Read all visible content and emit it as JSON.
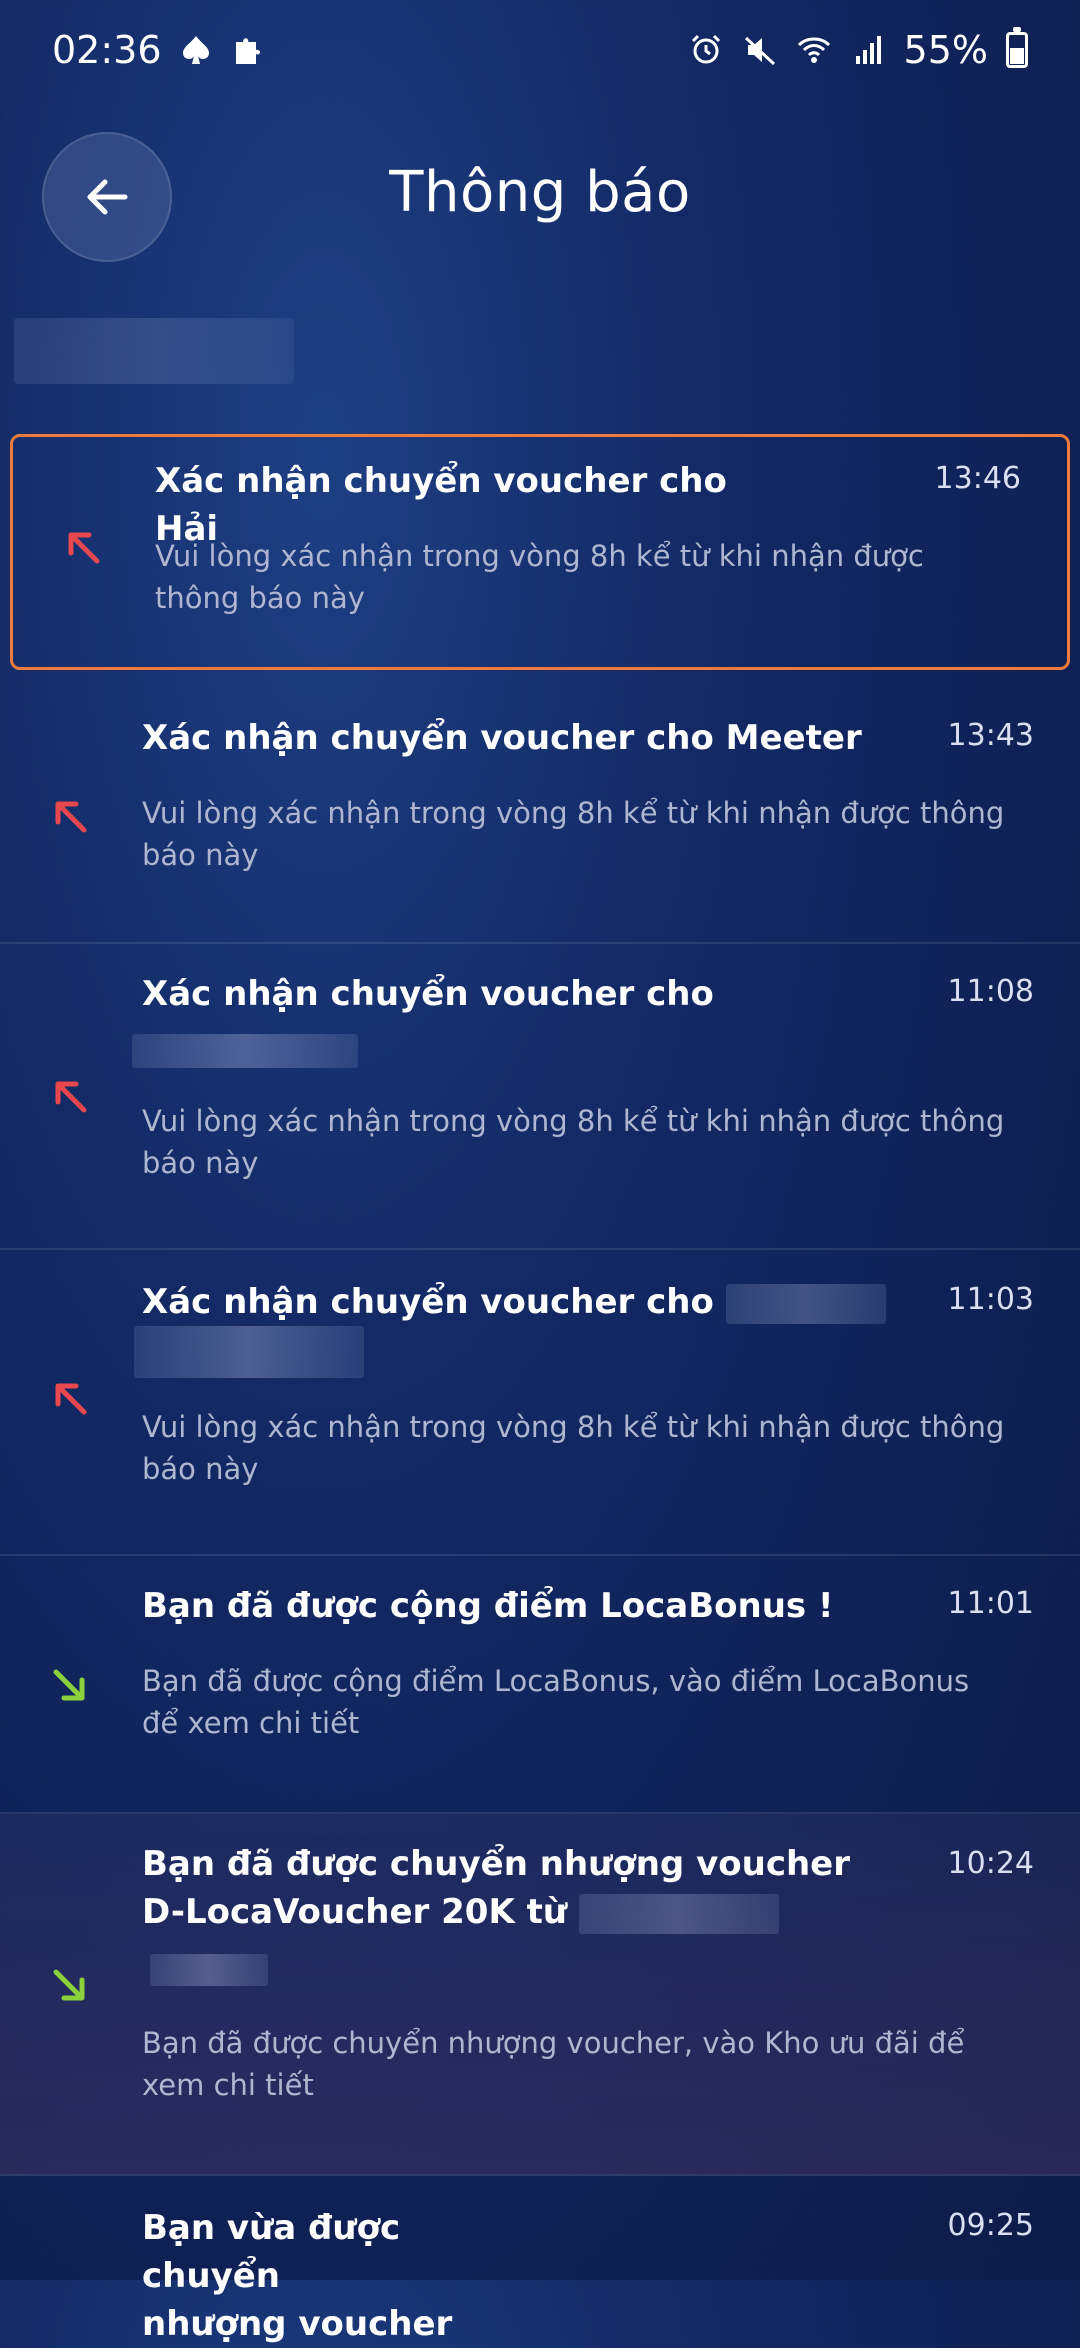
{
  "status_bar": {
    "time": "02:36",
    "battery": "55%",
    "left_icons": [
      "spade-icon",
      "puzzle-icon"
    ],
    "right_icons": [
      "alarm-icon",
      "mute-icon",
      "wifi-icon",
      "signal-icon",
      "battery-icon"
    ]
  },
  "header": {
    "title": "Thông báo",
    "back_icon": "arrow-left-icon"
  },
  "colors": {
    "outgoing_arrow": "#e8484d",
    "incoming_arrow": "#8bd13b",
    "highlight_border": "#f07a3a"
  },
  "notifications": [
    {
      "title_prefix": "Xác nhận chuyển voucher cho",
      "title_suffix": "Hải",
      "time": "13:46",
      "body": "Vui lòng xác nhận trong vòng 8h kể từ khi nhận được thông báo này",
      "direction": "outgoing"
    },
    {
      "title": "Xác nhận chuyển voucher cho Meeter",
      "time": "13:43",
      "body": "Vui lòng xác nhận trong vòng 8h kể từ khi nhận được thông báo này",
      "direction": "outgoing"
    },
    {
      "title": "Xác nhận chuyển voucher cho",
      "time": "11:08",
      "body": "Vui lòng xác nhận trong vòng 8h kể từ khi nhận được thông báo này",
      "direction": "outgoing"
    },
    {
      "title": "Xác nhận chuyển voucher cho",
      "time": "11:03",
      "body": "Vui lòng xác nhận trong vòng 8h kể từ khi nhận được thông báo này",
      "direction": "outgoing"
    },
    {
      "title": "Bạn đã được cộng điểm LocaBonus !",
      "time": "11:01",
      "body": "Bạn đã được cộng điểm LocaBonus, vào điểm LocaBonus để xem chi tiết",
      "direction": "incoming"
    },
    {
      "title_line1": "Bạn đã được chuyển nhượng voucher",
      "title_line2": "D-LocaVoucher 20K từ",
      "time": "10:24",
      "body": "Bạn đã được chuyển nhượng voucher, vào Kho ưu đãi để xem chi tiết",
      "direction": "incoming"
    },
    {
      "title_start": "Bạn vừa được",
      "title_end": "chuyển",
      "title_line2": "nhượng voucher",
      "time": "09:25",
      "direction": "incoming"
    }
  ]
}
